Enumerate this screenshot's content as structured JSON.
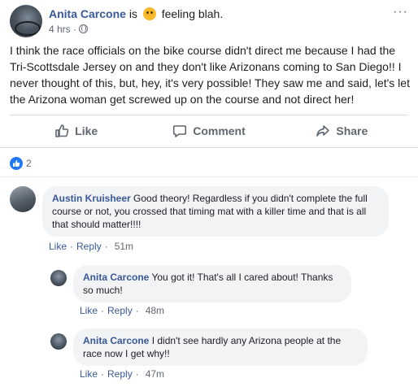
{
  "post": {
    "author": "Anita Carcone",
    "is_text": "is",
    "feeling": "feeling blah.",
    "feeling_icon": "sad-face-emoji",
    "time": "4 hrs",
    "time_sep": "·",
    "audience_icon": "globe-icon",
    "more_label": "···",
    "body": "I think the race officials on the bike course didn't direct me because I had the Tri-Scottsdale Jersey on and they don't like Arizonans coming to San Diego!! I never thought of this, but, hey, it's very possible! They saw me and said, let's let the Arizona woman get screwed up on the course and not direct her!"
  },
  "actions": {
    "like": "Like",
    "comment": "Comment",
    "share": "Share"
  },
  "reactions": {
    "count": "2",
    "icon": "thumbs-up-icon"
  },
  "comments": [
    {
      "name": "Austin Kruisheer",
      "text": "Good theory! Regardless if you didn't complete the full course or not, you crossed that timing mat with a killer time and that is all that should matter!!!!",
      "like": "Like",
      "reply": "Reply",
      "sep": "·",
      "time": "51m"
    },
    {
      "name": "Anita Carcone",
      "text": "You got it! That's all I cared about! Thanks so much!",
      "like": "Like",
      "reply": "Reply",
      "sep": "·",
      "time": "48m"
    },
    {
      "name": "Anita Carcone",
      "text": "I didn't see hardly any Arizona people at the race now I get why!!",
      "like": "Like",
      "reply": "Reply",
      "sep": "·",
      "time": "47m"
    }
  ],
  "colors": {
    "link": "#385898",
    "secondary_text": "#606770",
    "bubble": "#f2f3f5",
    "like_badge": "#2078f4"
  }
}
